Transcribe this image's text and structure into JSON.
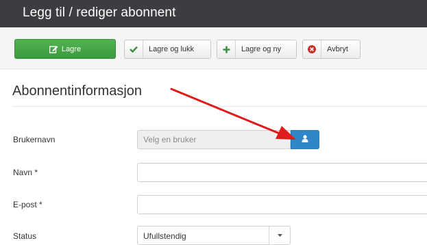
{
  "header": {
    "title": "Legg til / rediger abonnent"
  },
  "toolbar": {
    "save_label": "Lagre",
    "save_close_label": "Lagre og lukk",
    "save_new_label": "Lagre og ny",
    "cancel_label": "Avbryt"
  },
  "section": {
    "title": "Abonnentinformasjon"
  },
  "form": {
    "username": {
      "label": "Brukernavn",
      "placeholder": "Velg en bruker"
    },
    "name": {
      "label": "Navn *",
      "value": ""
    },
    "email": {
      "label": "E-post *",
      "value": ""
    },
    "status": {
      "label": "Status",
      "value": "Ufullstendig"
    }
  },
  "colors": {
    "header_bg": "#3b3d40",
    "save_green": "#45a745",
    "user_button_blue": "#2f86c8",
    "arrow_red": "#e01b1b",
    "cancel_red": "#c9302c"
  },
  "icons": {
    "save": "edit-icon",
    "save_close": "check-icon",
    "save_new": "plus-icon",
    "cancel": "cancel-circle-icon",
    "user": "user-icon",
    "dropdown": "caret-down-icon"
  }
}
